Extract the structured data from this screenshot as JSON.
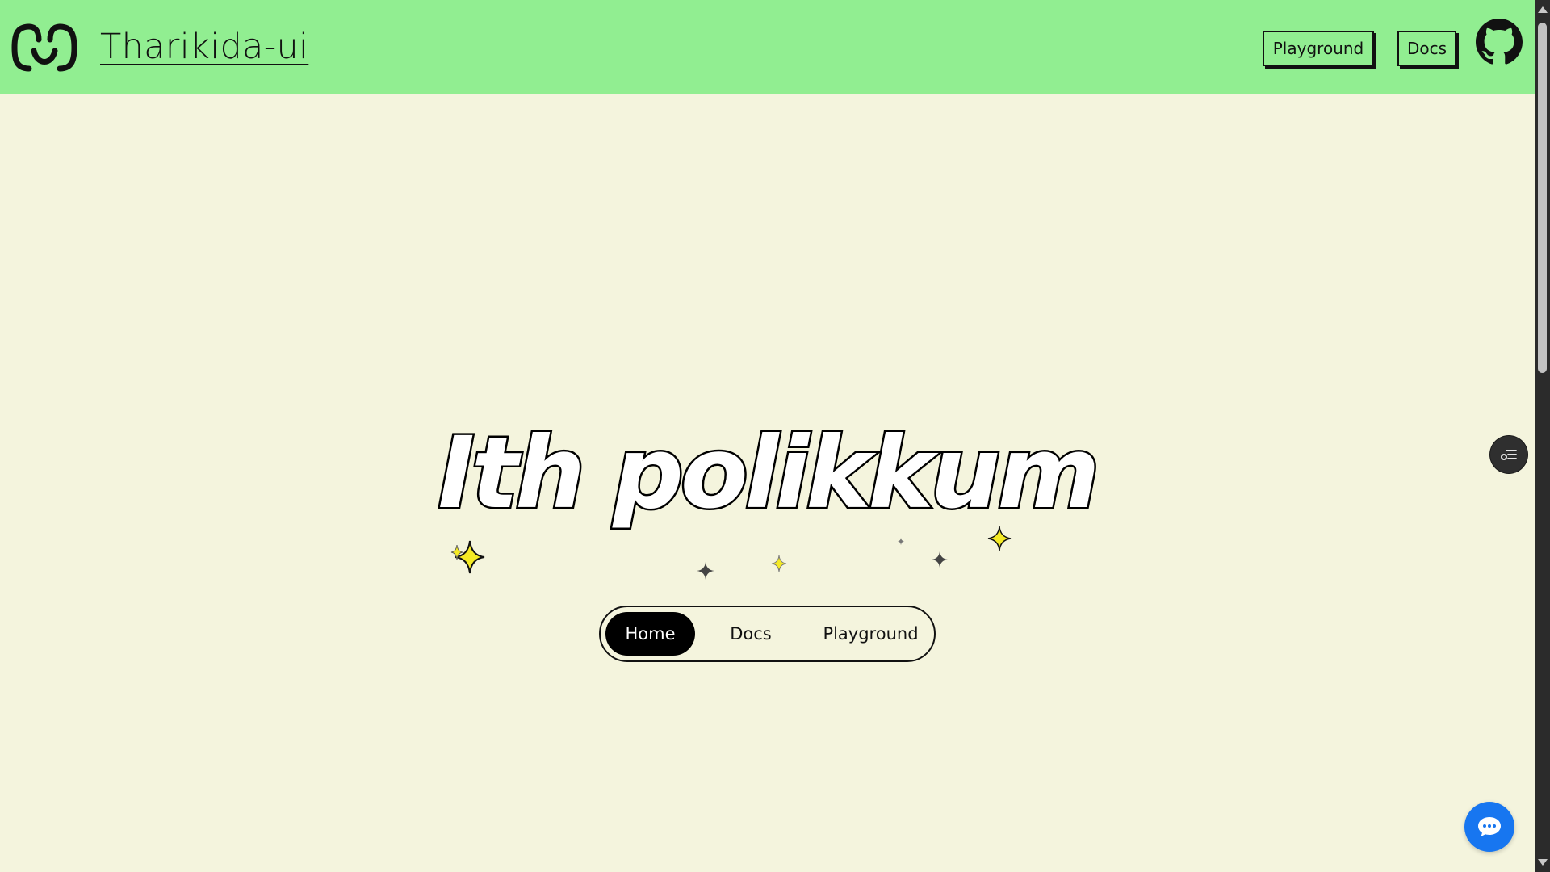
{
  "header": {
    "brand": "Tharikida-ui",
    "nav": [
      {
        "label": "Playground"
      },
      {
        "label": "Docs"
      }
    ],
    "icons": {
      "logo": "smiley-logo-icon",
      "github": "github-icon"
    },
    "background_color": "#91ee91"
  },
  "hero": {
    "title": "Ith polikkum",
    "decoration": "sparkles-icon"
  },
  "pill_nav": {
    "items": [
      {
        "label": "Home",
        "active": true
      },
      {
        "label": "Docs",
        "active": false
      },
      {
        "label": "Playground",
        "active": false
      }
    ]
  },
  "floating": {
    "side_button_icon": "settings-list-icon",
    "chat_button_icon": "chat-bubble-icon",
    "chat_color": "#1776f0"
  },
  "page": {
    "background_color": "#f4f4dd"
  }
}
